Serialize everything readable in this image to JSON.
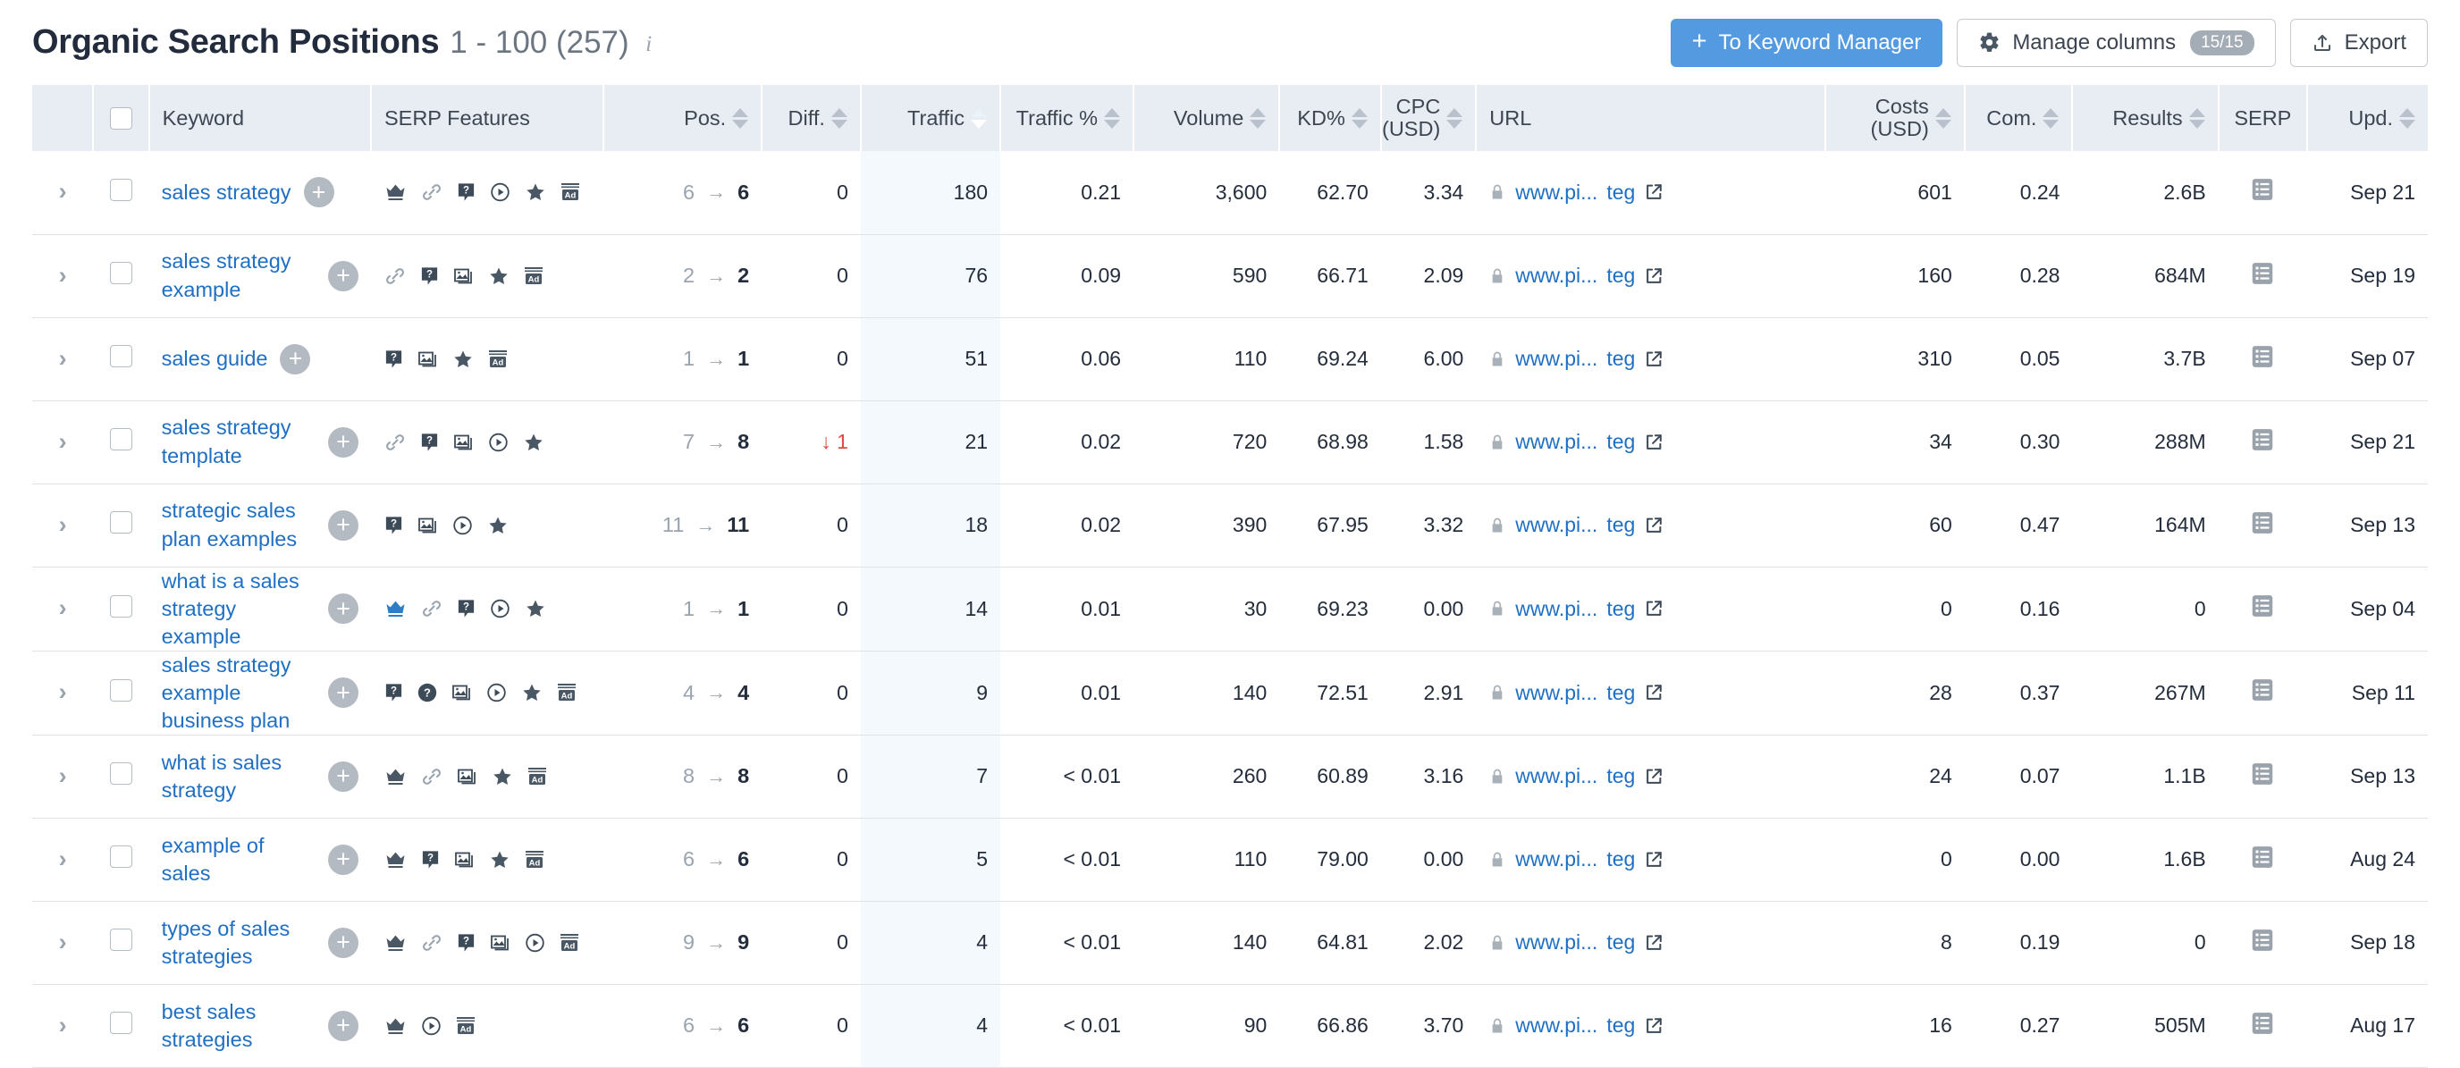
{
  "header": {
    "title": "Organic Search Positions",
    "range": "1 - 100 (257)",
    "info_icon": "info-icon",
    "buttons": {
      "keyword_manager": "To Keyword Manager",
      "manage_columns": "Manage columns",
      "columns_badge": "15/15",
      "export": "Export"
    }
  },
  "colors": {
    "accent": "#539ae0",
    "sorted_header": "#4d97e0",
    "header_bg": "#e8edf4",
    "link": "#1f6fc4",
    "negative": "#e2483d",
    "traffic_col_bg": "#f4f9fd",
    "crown_active": "#2c7fc4"
  },
  "table": {
    "columns": [
      {
        "key": "expander",
        "label": "",
        "sortable": false,
        "align": "center"
      },
      {
        "key": "select",
        "label": "",
        "sortable": false,
        "align": "center"
      },
      {
        "key": "keyword",
        "label": "Keyword",
        "sortable": false,
        "align": "left"
      },
      {
        "key": "serp_features",
        "label": "SERP Features",
        "sortable": false,
        "align": "left"
      },
      {
        "key": "pos",
        "label": "Pos.",
        "sortable": true,
        "align": "right"
      },
      {
        "key": "diff",
        "label": "Diff.",
        "sortable": true,
        "align": "right"
      },
      {
        "key": "traffic",
        "label": "Traffic",
        "sortable": true,
        "align": "right",
        "sorted": true
      },
      {
        "key": "traffic_pct",
        "label": "Traffic %",
        "sortable": true,
        "align": "right"
      },
      {
        "key": "volume",
        "label": "Volume",
        "sortable": true,
        "align": "right"
      },
      {
        "key": "kd",
        "label": "KD%",
        "sortable": true,
        "align": "right"
      },
      {
        "key": "cpc",
        "label": "CPC\n(USD)",
        "label_line1": "CPC",
        "label_line2": "(USD)",
        "sortable": true,
        "align": "right"
      },
      {
        "key": "url",
        "label": "URL",
        "sortable": false,
        "align": "left"
      },
      {
        "key": "costs",
        "label": "Costs\n(USD)",
        "label_line1": "Costs",
        "label_line2": "(USD)",
        "sortable": true,
        "align": "right"
      },
      {
        "key": "com",
        "label": "Com.",
        "sortable": true,
        "align": "right"
      },
      {
        "key": "results",
        "label": "Results",
        "sortable": true,
        "align": "right"
      },
      {
        "key": "serp",
        "label": "SERP",
        "sortable": false,
        "align": "center"
      },
      {
        "key": "upd",
        "label": "Upd.",
        "sortable": true,
        "align": "right"
      }
    ],
    "rows": [
      {
        "keyword": "sales strategy",
        "serp_features": [
          "crown",
          "link",
          "question-box",
          "video",
          "star",
          "ad"
        ],
        "crown_active": false,
        "pos_old": "6",
        "pos_new": "6",
        "diff": "0",
        "diff_down": false,
        "traffic": "180",
        "traffic_pct": "0.21",
        "volume": "3,600",
        "kd": "62.70",
        "cpc": "3.34",
        "url_main": "www.pi...",
        "url_tail": "teg",
        "costs": "601",
        "com": "0.24",
        "results": "2.6B",
        "upd": "Sep 21"
      },
      {
        "keyword": "sales strategy example",
        "serp_features": [
          "link",
          "question-box",
          "image",
          "star",
          "ad"
        ],
        "crown_active": false,
        "pos_old": "2",
        "pos_new": "2",
        "diff": "0",
        "diff_down": false,
        "traffic": "76",
        "traffic_pct": "0.09",
        "volume": "590",
        "kd": "66.71",
        "cpc": "2.09",
        "url_main": "www.pi...",
        "url_tail": "teg",
        "costs": "160",
        "com": "0.28",
        "results": "684M",
        "upd": "Sep 19"
      },
      {
        "keyword": "sales guide",
        "serp_features": [
          "question-box",
          "image",
          "star",
          "ad"
        ],
        "crown_active": false,
        "pos_old": "1",
        "pos_new": "1",
        "diff": "0",
        "diff_down": false,
        "traffic": "51",
        "traffic_pct": "0.06",
        "volume": "110",
        "kd": "69.24",
        "cpc": "6.00",
        "url_main": "www.pi...",
        "url_tail": "teg",
        "costs": "310",
        "com": "0.05",
        "results": "3.7B",
        "upd": "Sep 07"
      },
      {
        "keyword": "sales strategy template",
        "serp_features": [
          "link",
          "question-box",
          "image",
          "video",
          "star"
        ],
        "crown_active": false,
        "pos_old": "7",
        "pos_new": "8",
        "diff": "1",
        "diff_down": true,
        "traffic": "21",
        "traffic_pct": "0.02",
        "volume": "720",
        "kd": "68.98",
        "cpc": "1.58",
        "url_main": "www.pi...",
        "url_tail": "teg",
        "costs": "34",
        "com": "0.30",
        "results": "288M",
        "upd": "Sep 21"
      },
      {
        "keyword": "strategic sales plan examples",
        "serp_features": [
          "question-box",
          "image",
          "video",
          "star"
        ],
        "crown_active": false,
        "pos_old": "11",
        "pos_new": "11",
        "diff": "0",
        "diff_down": false,
        "traffic": "18",
        "traffic_pct": "0.02",
        "volume": "390",
        "kd": "67.95",
        "cpc": "3.32",
        "url_main": "www.pi...",
        "url_tail": "teg",
        "costs": "60",
        "com": "0.47",
        "results": "164M",
        "upd": "Sep 13"
      },
      {
        "keyword": "what is a sales strategy example",
        "serp_features": [
          "crown",
          "link",
          "question-box",
          "video",
          "star"
        ],
        "crown_active": true,
        "pos_old": "1",
        "pos_new": "1",
        "diff": "0",
        "diff_down": false,
        "traffic": "14",
        "traffic_pct": "0.01",
        "volume": "30",
        "kd": "69.23",
        "cpc": "0.00",
        "url_main": "www.pi...",
        "url_tail": "teg",
        "costs": "0",
        "com": "0.16",
        "results": "0",
        "upd": "Sep 04"
      },
      {
        "keyword": "sales strategy example business plan",
        "serp_features": [
          "question-box",
          "faq",
          "image",
          "video",
          "star",
          "ad"
        ],
        "crown_active": false,
        "pos_old": "4",
        "pos_new": "4",
        "diff": "0",
        "diff_down": false,
        "traffic": "9",
        "traffic_pct": "0.01",
        "volume": "140",
        "kd": "72.51",
        "cpc": "2.91",
        "url_main": "www.pi...",
        "url_tail": "teg",
        "costs": "28",
        "com": "0.37",
        "results": "267M",
        "upd": "Sep 11"
      },
      {
        "keyword": "what is sales strategy",
        "serp_features": [
          "crown",
          "link",
          "image",
          "star",
          "ad"
        ],
        "crown_active": false,
        "pos_old": "8",
        "pos_new": "8",
        "diff": "0",
        "diff_down": false,
        "traffic": "7",
        "traffic_pct": "< 0.01",
        "volume": "260",
        "kd": "60.89",
        "cpc": "3.16",
        "url_main": "www.pi...",
        "url_tail": "teg",
        "costs": "24",
        "com": "0.07",
        "results": "1.1B",
        "upd": "Sep 13"
      },
      {
        "keyword": "example of sales",
        "serp_features": [
          "crown",
          "question-box",
          "image",
          "star",
          "ad"
        ],
        "crown_active": false,
        "pos_old": "6",
        "pos_new": "6",
        "diff": "0",
        "diff_down": false,
        "traffic": "5",
        "traffic_pct": "< 0.01",
        "volume": "110",
        "kd": "79.00",
        "cpc": "0.00",
        "url_main": "www.pi...",
        "url_tail": "teg",
        "costs": "0",
        "com": "0.00",
        "results": "1.6B",
        "upd": "Aug 24"
      },
      {
        "keyword": "types of sales strategies",
        "serp_features": [
          "crown",
          "link",
          "question-box",
          "image",
          "video",
          "ad"
        ],
        "crown_active": false,
        "pos_old": "9",
        "pos_new": "9",
        "diff": "0",
        "diff_down": false,
        "traffic": "4",
        "traffic_pct": "< 0.01",
        "volume": "140",
        "kd": "64.81",
        "cpc": "2.02",
        "url_main": "www.pi...",
        "url_tail": "teg",
        "costs": "8",
        "com": "0.19",
        "results": "0",
        "upd": "Sep 18"
      },
      {
        "keyword": "best sales strategies",
        "serp_features": [
          "crown",
          "video",
          "ad"
        ],
        "crown_active": false,
        "pos_old": "6",
        "pos_new": "6",
        "diff": "0",
        "diff_down": false,
        "traffic": "4",
        "traffic_pct": "< 0.01",
        "volume": "90",
        "kd": "66.86",
        "cpc": "3.70",
        "url_main": "www.pi...",
        "url_tail": "teg",
        "costs": "16",
        "com": "0.27",
        "results": "505M",
        "upd": "Aug 17"
      }
    ]
  }
}
